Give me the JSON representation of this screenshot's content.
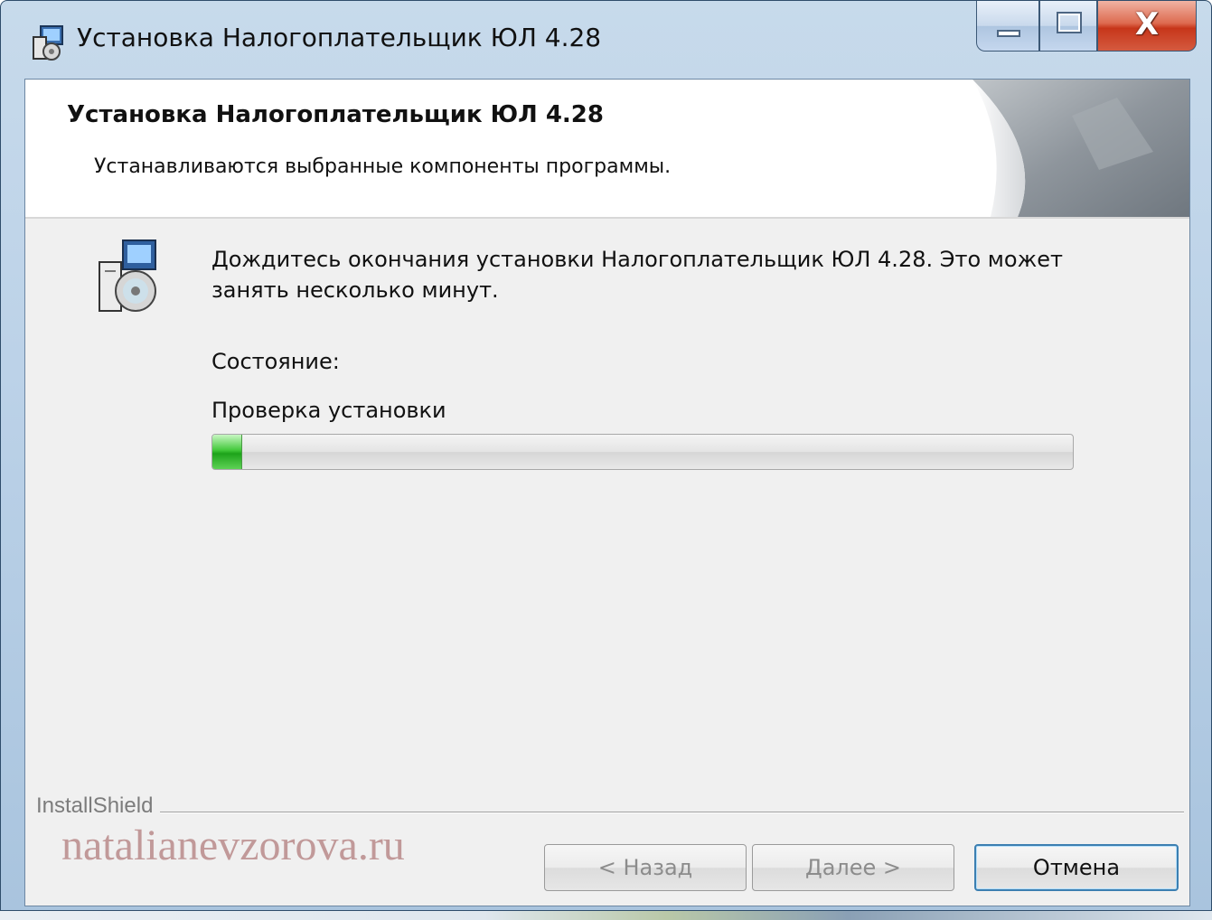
{
  "window": {
    "title": "Установка Налогоплательщик ЮЛ 4.28",
    "close_glyph": "X"
  },
  "header": {
    "title": "Установка Налогоплательщик ЮЛ 4.28",
    "subtitle": "Устанавливаются выбранные компоненты программы."
  },
  "body": {
    "message": "Дождитесь окончания установки Налогоплательщик ЮЛ 4.28. Это может занять несколько минут.",
    "status_label": "Состояние:",
    "status_value": "Проверка установки",
    "progress_fraction": 0.035
  },
  "footer": {
    "brand": "InstallShield",
    "back_label": "< Назад",
    "next_label": "Далее >",
    "cancel_label": "Отмена"
  },
  "watermark": "natalianevzorova.ru",
  "colors": {
    "progress_green": "#1da31a",
    "cancel_focus": "#3c7fb1"
  }
}
